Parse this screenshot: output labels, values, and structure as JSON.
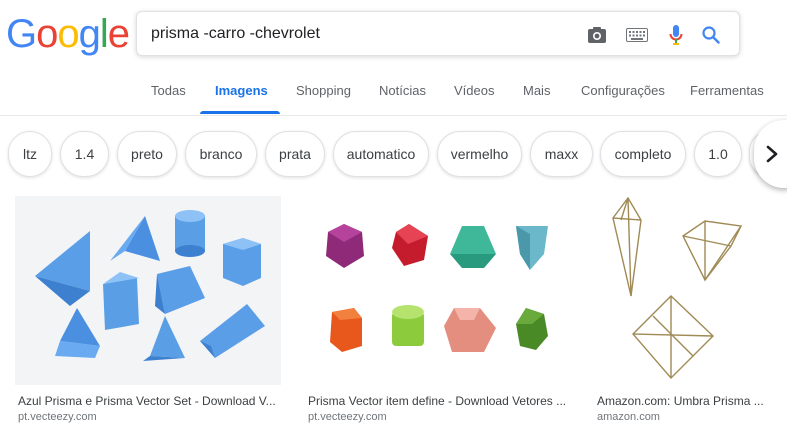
{
  "logo": {
    "letters": [
      "G",
      "o",
      "o",
      "g",
      "l",
      "e"
    ]
  },
  "search": {
    "query": "prisma -carro -chevrolet"
  },
  "icons": {
    "camera": "camera-icon",
    "keyboard": "keyboard-icon",
    "mic": "microphone-icon",
    "search": "search-icon"
  },
  "tabs": {
    "todas": "Todas",
    "imagens": "Imagens",
    "shopping": "Shopping",
    "noticias": "Notícias",
    "videos": "Vídeos",
    "mais": "Mais",
    "config": "Configurações",
    "ferramentas": "Ferramentas"
  },
  "chips": [
    "ltz",
    "1.4",
    "preto",
    "branco",
    "prata",
    "automatico",
    "vermelho",
    "maxx",
    "completo",
    "1.0"
  ],
  "results": [
    {
      "title": "Azul Prisma e Prisma Vector Set - Download V...",
      "source": "pt.vecteezy.com"
    },
    {
      "title": "Prisma Vector item define - Download Vetores ...",
      "source": "pt.vecteezy.com"
    },
    {
      "title": "Amazon.com: Umbra Prisma ...",
      "source": "amazon.com"
    }
  ],
  "colors": {
    "blue": "#4285f4",
    "red": "#ea4335",
    "yellow": "#fbbc05",
    "green": "#34a853",
    "accent": "#1a73e8"
  }
}
